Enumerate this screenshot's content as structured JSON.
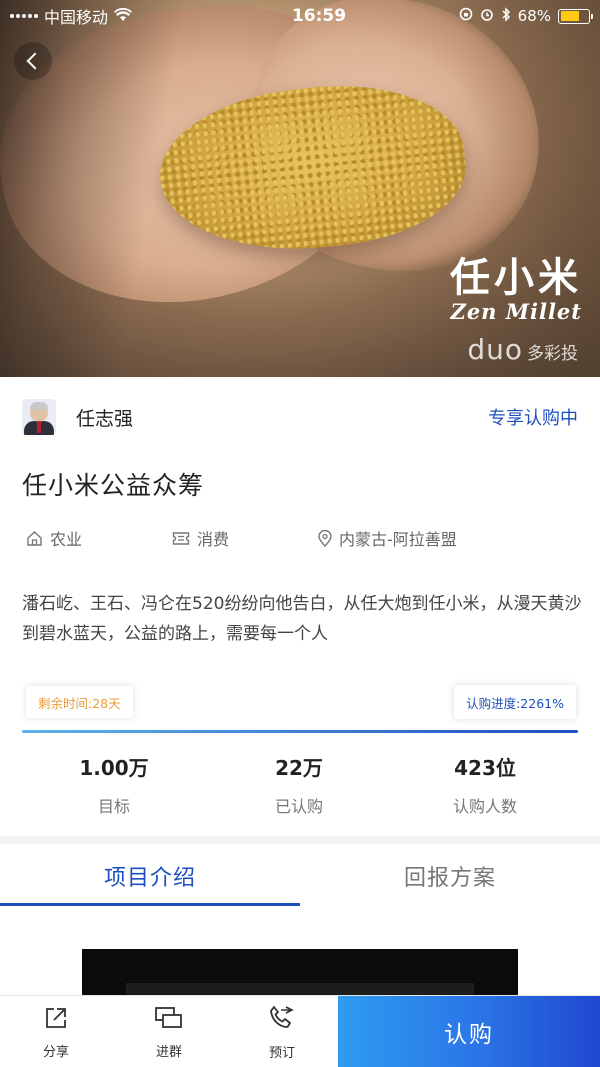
{
  "status_bar": {
    "carrier": "中国移动",
    "time": "16:59",
    "battery": "68%"
  },
  "hero": {
    "brand_cn": "任小米",
    "brand_en": "Zen Millet",
    "watermark_duo": "duo",
    "watermark_cn": "多彩投",
    "icons": [
      "back-chevron-icon",
      "wifi-icon",
      "alarm-icon",
      "bluetooth-icon",
      "battery-icon"
    ]
  },
  "author": {
    "name": "任志强",
    "badge": "专享认购中"
  },
  "project": {
    "title": "任小米公益众筹",
    "tags": [
      {
        "icon": "house-icon",
        "label": "农业"
      },
      {
        "icon": "ticket-icon",
        "label": "消费"
      },
      {
        "icon": "location-pin-icon",
        "label": "内蒙古-阿拉善盟"
      }
    ],
    "description": "潘石屹、王石、冯仑在520纷纷向他告白，从任大炮到任小米，从漫天黄沙到碧水蓝天，公益的路上，需要每一个人"
  },
  "progress": {
    "remaining_label": "剩余时间:28天",
    "progress_label": "认购进度:2261%",
    "fill_fraction": 1.0
  },
  "stats": [
    {
      "value": "1.00万",
      "label": "目标"
    },
    {
      "value": "22万",
      "label": "已认购"
    },
    {
      "value": "423位",
      "label": "认购人数"
    }
  ],
  "tabs": [
    {
      "label": "项目介绍",
      "active": true
    },
    {
      "label": "回报方案",
      "active": false
    }
  ],
  "bottom_bar": {
    "share": "分享",
    "join_group": "进群",
    "book": "预订",
    "buy": "认购"
  },
  "colors": {
    "accent": "#1e4fbf",
    "orange": "#ef9a3a",
    "buy_gradient_start": "#2d9cf0",
    "buy_gradient_end": "#1f48cf"
  }
}
